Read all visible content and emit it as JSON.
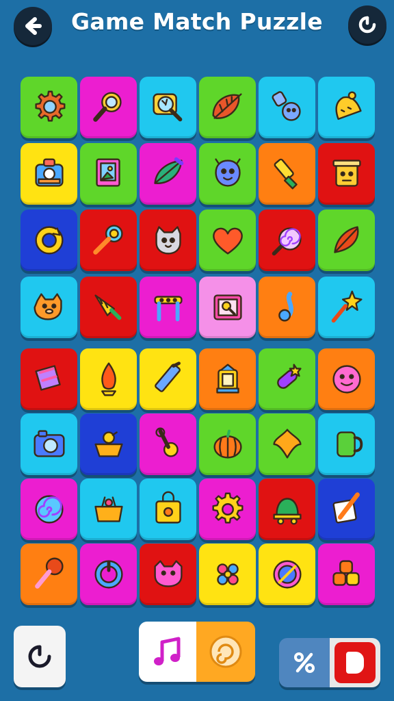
{
  "header": {
    "title": "Game Match Puzzle"
  },
  "colors": {
    "background": "#1d6fa6",
    "tile_green": "#5fd62a",
    "tile_magenta": "#ec1ed0",
    "tile_cyan": "#20c8ef",
    "tile_yellow": "#ffe312",
    "tile_orange": "#ff7f12",
    "tile_red": "#e01212",
    "tile_blue": "#1f3fd6",
    "tile_pink": "#f590e8"
  },
  "board": {
    "rows": [
      [
        {
          "color": "green",
          "icon": "gear-icon"
        },
        {
          "color": "magenta",
          "icon": "magnifier-icon"
        },
        {
          "color": "cyan",
          "icon": "search-map-icon"
        },
        {
          "color": "green",
          "icon": "leaf-icon"
        },
        {
          "color": "cyan",
          "icon": "critter-icon"
        },
        {
          "color": "cyan",
          "icon": "bell-icon"
        }
      ],
      [
        {
          "color": "yellow",
          "icon": "camera-bag-icon"
        },
        {
          "color": "green",
          "icon": "picture-frame-icon"
        },
        {
          "color": "magenta",
          "icon": "feather-leaf-icon"
        },
        {
          "color": "green",
          "icon": "monster-icon"
        },
        {
          "color": "orange",
          "icon": "paint-tube-icon"
        },
        {
          "color": "red",
          "icon": "trash-can-face-icon"
        }
      ],
      [
        {
          "color": "blue",
          "icon": "refresh-ring-icon"
        },
        {
          "color": "red",
          "icon": "rattle-icon"
        },
        {
          "color": "red",
          "icon": "cat-icon"
        },
        {
          "color": "green",
          "icon": "heart-icon"
        },
        {
          "color": "red",
          "icon": "spiral-candy-icon"
        },
        {
          "color": "green",
          "icon": "pepper-leaf-icon"
        }
      ],
      [
        {
          "color": "cyan",
          "icon": "bear-icon"
        },
        {
          "color": "red",
          "icon": "party-horn-icon"
        },
        {
          "color": "magenta",
          "icon": "stool-icon"
        },
        {
          "color": "pink",
          "icon": "frame-magnifier-icon"
        },
        {
          "color": "orange",
          "icon": "music-note-icon"
        },
        {
          "color": "cyan",
          "icon": "star-wand-icon"
        }
      ],
      [
        {
          "color": "red",
          "icon": "flag-icon"
        },
        {
          "color": "yellow",
          "icon": "flame-icon"
        },
        {
          "color": "yellow",
          "icon": "crayon-icon"
        },
        {
          "color": "orange",
          "icon": "lantern-icon"
        },
        {
          "color": "green",
          "icon": "pickle-icon"
        },
        {
          "color": "orange",
          "icon": "face-badge-icon"
        }
      ],
      [
        {
          "color": "cyan",
          "icon": "camera-icon"
        },
        {
          "color": "blue",
          "icon": "basket-bird-icon"
        },
        {
          "color": "magenta",
          "icon": "key-ring-icon"
        },
        {
          "color": "green",
          "icon": "pumpkin-icon"
        },
        {
          "color": "green",
          "icon": "diamond-clover-icon"
        },
        {
          "color": "cyan",
          "icon": "mug-icon"
        }
      ],
      [
        {
          "color": "magenta",
          "icon": "swirl-icon"
        },
        {
          "color": "cyan",
          "icon": "gift-basket-icon"
        },
        {
          "color": "cyan",
          "icon": "shopping-bag-icon"
        },
        {
          "color": "magenta",
          "icon": "cog-icon"
        },
        {
          "color": "red",
          "icon": "bell-cart-icon"
        },
        {
          "color": "blue",
          "icon": "pencil-paper-icon"
        }
      ],
      [
        {
          "color": "orange",
          "icon": "maraca-icon"
        },
        {
          "color": "magenta",
          "icon": "power-ring-icon"
        },
        {
          "color": "red",
          "icon": "cat-face-icon"
        },
        {
          "color": "yellow",
          "icon": "flower-candy-icon"
        },
        {
          "color": "yellow",
          "icon": "compass-icon"
        },
        {
          "color": "magenta",
          "icon": "blocks-icon"
        }
      ]
    ]
  },
  "controls": {
    "restart": {
      "icon": "restart-icon"
    },
    "music": {
      "icon": "music-note-icon"
    },
    "hint": {
      "icon": "swirl-coin-icon"
    },
    "percent": {
      "icon": "percent-key-icon"
    },
    "stop": {
      "icon": "stop-icon"
    }
  }
}
